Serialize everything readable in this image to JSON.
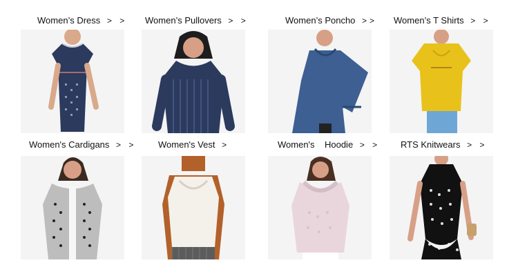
{
  "categories": [
    {
      "id": "dress",
      "label": "Women’s Dress",
      "chevrons": "> >",
      "icon": "dress-photo"
    },
    {
      "id": "pullovers",
      "label": "Women’s Pullovers",
      "chevrons": "> >",
      "icon": "pullover-photo"
    },
    {
      "id": "poncho",
      "label": "Women’s Poncho",
      "chevrons": ">>",
      "icon": "poncho-photo"
    },
    {
      "id": "tshirts",
      "label": "Women’s  T Shirts",
      "chevrons": "> >",
      "icon": "tshirt-photo"
    },
    {
      "id": "cardigans",
      "label": "Women's Cardigans",
      "chevrons": "> >",
      "icon": "cardigan-photo"
    },
    {
      "id": "vest",
      "label": "Women's Vest",
      "chevrons": ">",
      "icon": "vest-photo"
    },
    {
      "id": "hoodie",
      "label": "Women's    Hoodie",
      "chevrons": "> >",
      "icon": "hoodie-photo"
    },
    {
      "id": "rts",
      "label": "RTS Knitwears",
      "chevrons": "> >",
      "icon": "polka-dress-photo"
    }
  ],
  "colors": {
    "bg": "#ffffff",
    "photo_bg": "#f2f2f2",
    "navy": "#2c3a5e",
    "mustard": "#e8c21b",
    "grey": "#bdbdbd",
    "rust": "#b3612a",
    "cream": "#f4f1ea",
    "pink": "#e9d6dc",
    "dark": "#111111"
  }
}
